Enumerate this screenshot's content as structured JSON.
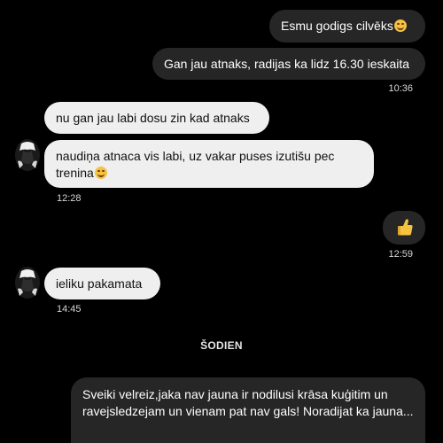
{
  "messages": {
    "out1": {
      "text": "Esmu godigs cilvēks",
      "emoji": "grinning-face"
    },
    "out2": {
      "text": "Gan jau atnaks, radijas ka lidz 16.30 ieskaita",
      "time": "10:36"
    },
    "in1": {
      "text": "nu gan jau labi dosu zin kad atnaks"
    },
    "in2": {
      "text": "naudiņa atnaca vis labi, uz vakar puses izutišu pec trenina",
      "emoji": "relieved-face",
      "time": "12:28"
    },
    "out3": {
      "emoji": "thumbs-up",
      "time": "12:59"
    },
    "in3": {
      "text": "ieliku pakamata",
      "time": "14:45"
    },
    "out4": {
      "text": "Sveiki velreiz,jaka nav jauna ir nodilusi krāsa kuģitim un ravejsledzejam un vienam pat nav gals! Noradijat ka jauna..."
    }
  },
  "divider": {
    "label": "ŠODIEN"
  },
  "colors": {
    "background": "#000000",
    "outgoing_bubble": "#262626",
    "incoming_bubble": "#efefef",
    "incoming_text": "#111111",
    "outgoing_text": "#ffffff"
  }
}
